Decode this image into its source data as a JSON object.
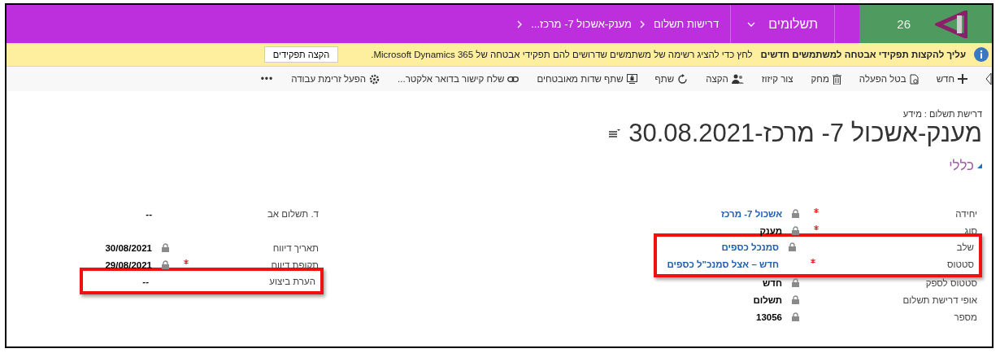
{
  "header": {
    "logo_text": "26",
    "app": "תשלומים",
    "breadcrumbs": [
      "דרישות תשלום",
      "מענק-אשכול 7- מרכז..."
    ]
  },
  "notification": {
    "title": "עליך להקצות תפקידי אבטחה למשתמשים חדשים",
    "message": "לחץ כדי להציג רשימה של משתמשים שדרושים להם תפקידי אבטחה של Microsoft Dynamics 365.",
    "button": "הקצה תפקידים"
  },
  "toolbar": [
    {
      "kind": "new",
      "label": "חדש"
    },
    {
      "kind": "deactivate",
      "label": "בטל הפעלה"
    },
    {
      "kind": "delete",
      "label": "מחק"
    },
    {
      "kind": "plain",
      "label": "צור קיזוז"
    },
    {
      "kind": "assign",
      "label": "הקצה"
    },
    {
      "kind": "share",
      "label": "שתף"
    },
    {
      "kind": "secure",
      "label": "שתף שדות מאובטחים"
    },
    {
      "kind": "link",
      "label": "שלח קישור בדואר אלקטר..."
    },
    {
      "kind": "workflow",
      "label": "הפעל זרימת עבודה"
    },
    {
      "kind": "more",
      "label": "•••"
    }
  ],
  "record": {
    "entity": "דרישת תשלום : מידע",
    "title": "מענק-אשכול 7- מרכז-30.08.2021",
    "section": "כללי"
  },
  "columns": [
    [
      {
        "kind": "field",
        "label": "יחידה",
        "value": "אשכול 7- מרכז",
        "required": true,
        "locked": true,
        "link": true,
        "highlighted": false
      },
      {
        "kind": "field",
        "label": "סוג",
        "value": "מענק",
        "required": true,
        "locked": true,
        "link": false,
        "highlighted": false
      },
      {
        "kind": "field",
        "label": "שלב",
        "value": "סמנכל כספים",
        "required": false,
        "locked": true,
        "link": true,
        "highlighted": true
      },
      {
        "kind": "field",
        "label": "סטטוס",
        "value": "חדש – אצל סמנכ\"ל כספים",
        "required": true,
        "locked": false,
        "link": true,
        "highlighted": true
      },
      {
        "kind": "field",
        "label": "סטטוס לספק",
        "value": "חדש",
        "required": false,
        "locked": true,
        "link": false,
        "highlighted": false
      },
      {
        "kind": "field",
        "label": "אופי דרישת תשלום",
        "value": "תשלום",
        "required": false,
        "locked": true,
        "link": false,
        "highlighted": false
      },
      {
        "kind": "field",
        "label": "מספר",
        "value": "13056",
        "required": false,
        "locked": true,
        "link": false,
        "highlighted": false
      }
    ],
    [
      {
        "kind": "field",
        "label": "ד. תשלום אב",
        "value": "--",
        "required": false,
        "locked": false,
        "link": false,
        "highlighted": false
      },
      {
        "kind": "blank"
      },
      {
        "kind": "field",
        "label": "תאריך דיווח",
        "value": "30/08/2021",
        "required": false,
        "locked": true,
        "link": false,
        "highlighted": false
      },
      {
        "kind": "field",
        "label": "תקופת דיווח",
        "value": "29/08/2021",
        "required": true,
        "locked": true,
        "link": false,
        "highlighted": false
      },
      {
        "kind": "field",
        "label": "הערת ביצוע",
        "value": "--",
        "required": false,
        "locked": false,
        "link": false,
        "highlighted": true
      }
    ]
  ]
}
